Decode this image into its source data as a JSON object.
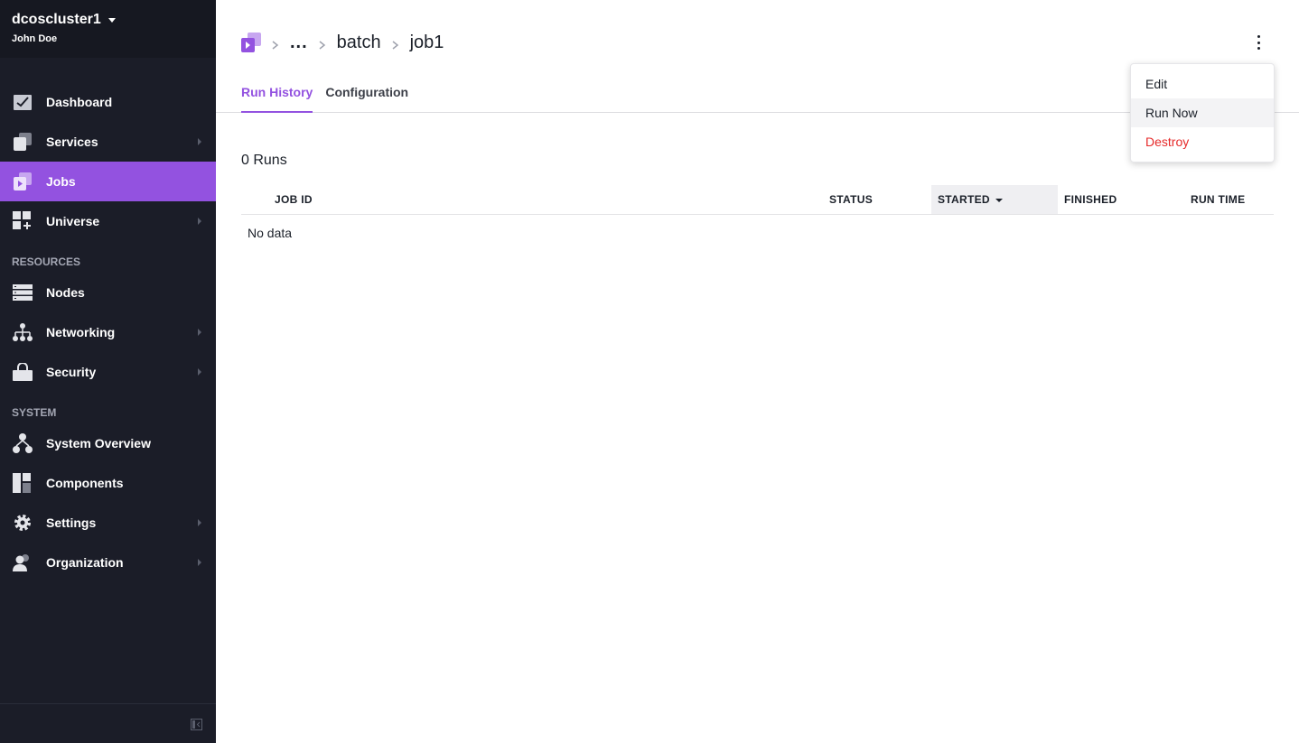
{
  "sidebar": {
    "cluster_name": "dcoscluster1",
    "user_name": "John Doe",
    "items": [
      {
        "label": "Dashboard",
        "icon": "dashboard-icon"
      },
      {
        "label": "Services",
        "icon": "services-icon"
      },
      {
        "label": "Jobs",
        "icon": "jobs-icon"
      },
      {
        "label": "Universe",
        "icon": "universe-icon"
      }
    ],
    "resources_label": "RESOURCES",
    "resources_items": [
      {
        "label": "Nodes",
        "icon": "nodes-icon"
      },
      {
        "label": "Networking",
        "icon": "networking-icon"
      },
      {
        "label": "Security",
        "icon": "security-icon"
      }
    ],
    "system_label": "SYSTEM",
    "system_items": [
      {
        "label": "System Overview",
        "icon": "system-overview-icon"
      },
      {
        "label": "Components",
        "icon": "components-icon"
      },
      {
        "label": "Settings",
        "icon": "settings-icon"
      },
      {
        "label": "Organization",
        "icon": "organization-icon"
      }
    ]
  },
  "breadcrumb": {
    "ellipsis": "...",
    "parent": "batch",
    "current": "job1"
  },
  "tabs": [
    {
      "label": "Run History"
    },
    {
      "label": "Configuration"
    }
  ],
  "runs": {
    "count_label": "0 Runs",
    "columns": [
      "JOB ID",
      "STATUS",
      "STARTED",
      "FINISHED",
      "RUN TIME"
    ],
    "empty_text": "No data"
  },
  "menu": {
    "items": [
      {
        "label": "Edit"
      },
      {
        "label": "Run Now"
      },
      {
        "label": "Destroy"
      }
    ]
  },
  "colors": {
    "accent": "#9352e0",
    "sidebar_bg": "#1b1d28",
    "danger": "#e62a2a"
  }
}
